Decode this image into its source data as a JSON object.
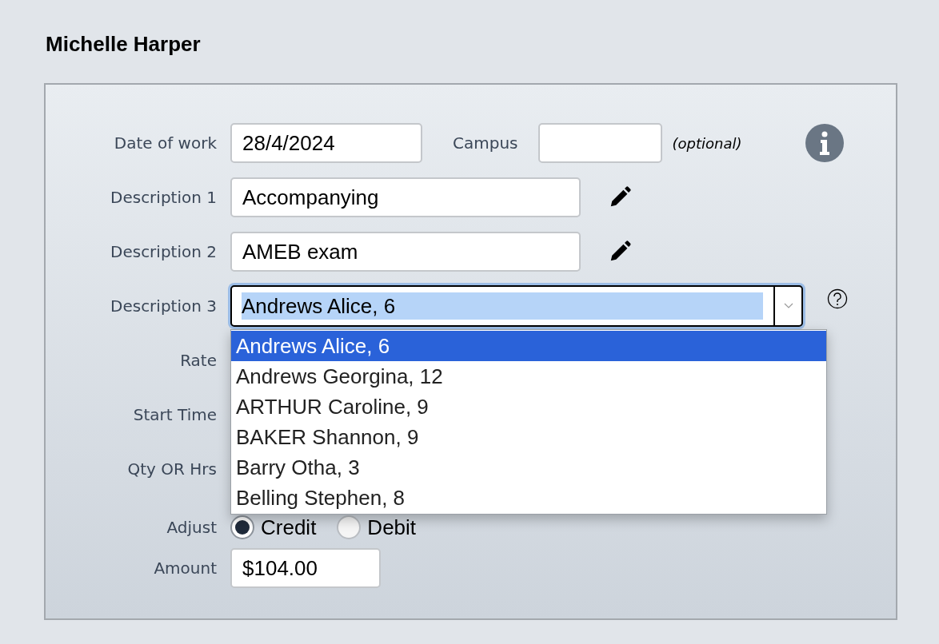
{
  "heading": "Michelle Harper",
  "rows": [
    {
      "kind": "date",
      "label": "Date of work",
      "value": "28/4/2024",
      "second_label": "Campus",
      "note": "(optional)"
    },
    {
      "kind": "edit",
      "label": "Description 1",
      "value": "Accompanying"
    },
    {
      "kind": "edit",
      "label": "Description 2",
      "value": "AMEB exam"
    },
    {
      "kind": "combo",
      "label": "Description 3",
      "value": "Andrews Alice, 6",
      "expanded": true,
      "options": [
        {
          "label": "Andrews Alice, 6",
          "selected": true
        },
        {
          "label": "Andrews Georgina, 12",
          "selected": false
        },
        {
          "label": "ARTHUR Caroline, 9",
          "selected": false
        },
        {
          "label": "BAKER Shannon, 9",
          "selected": false
        },
        {
          "label": "Barry Otha, 3",
          "selected": false
        },
        {
          "label": "Belling Stephen, 8",
          "selected": false
        }
      ]
    },
    {
      "kind": "covered",
      "label": "Rate"
    },
    {
      "kind": "covered",
      "label": "Start Time"
    },
    {
      "kind": "covered",
      "label": "Qty OR Hrs"
    },
    {
      "kind": "radio",
      "label": "Adjust",
      "options": [
        {
          "label": "Credit",
          "selected": true
        },
        {
          "label": "Debit",
          "selected": false
        }
      ]
    },
    {
      "kind": "amount",
      "label": "Amount",
      "value": "$104.00"
    }
  ]
}
